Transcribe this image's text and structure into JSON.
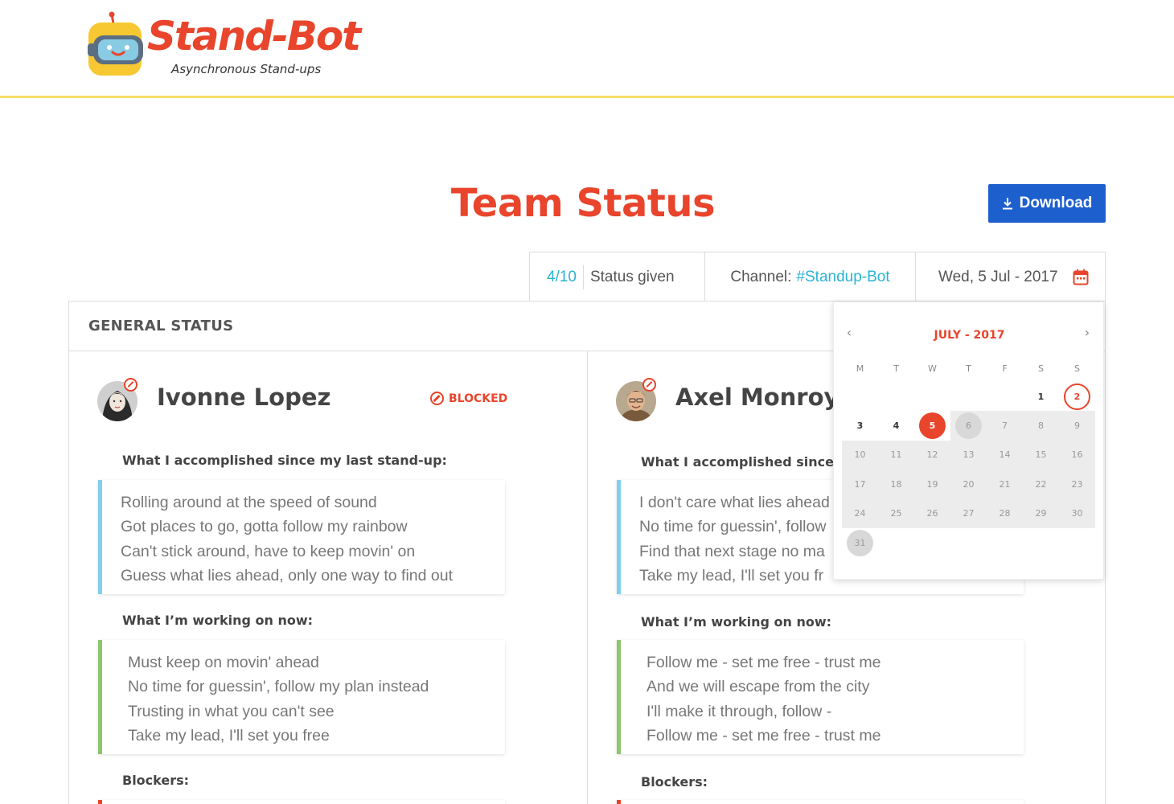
{
  "brand": {
    "name": "Stand-Bot",
    "tagline": "Asynchronous Stand-ups",
    "colors": {
      "red": "#e8452c",
      "yellow": "#f7df68",
      "blue": "#1e5fce",
      "cyan": "#29b3d3"
    }
  },
  "page": {
    "title": "Team Status"
  },
  "toolbar": {
    "download_label": "Download",
    "download_icon": "download-icon"
  },
  "status_bar": {
    "count": "4/10",
    "given_label": "Status given",
    "channel_label": "Channel:",
    "channel_value": "#Standup-Bot",
    "date_value": "Wed, 5 Jul - 2017",
    "date_icon": "calendar-icon"
  },
  "card": {
    "heading": "GENERAL STATUS"
  },
  "members": [
    {
      "name": "Ivonne Lopez",
      "status": "BLOCKED",
      "q1": "What I accomplished since my last stand-up:",
      "a1": [
        "Rolling around at the speed of sound",
        "Got places to go, gotta follow my rainbow",
        "Can't stick around, have to keep movin' on",
        "Guess what lies ahead, only one way to find out"
      ],
      "q2": "What I’m working on now:",
      "a2": [
        "Must keep on movin' ahead",
        "No time for guessin', follow my plan instead",
        "Trusting in what you can't see",
        "Take my lead, I'll set you free"
      ],
      "q3": "Blockers:"
    },
    {
      "name": "Axel Monroy",
      "q1": "What I accomplished since n",
      "a1": [
        "I don't care what lies ahead",
        "No time for guessin', follow",
        "Find that next stage no ma",
        "Take my lead, I'll set you fr"
      ],
      "q2": "What I’m working on now:",
      "a2": [
        "Follow me - set me free - trust me",
        "And we will escape from the city",
        "I'll make it through, follow -",
        "Follow me - set me free - trust me"
      ],
      "q3": "Blockers:"
    }
  ],
  "calendar": {
    "month_label": "JULY - 2017",
    "prev": "‹",
    "next": "›",
    "weekdays": [
      "M",
      "T",
      "W",
      "T",
      "F",
      "S",
      "S"
    ],
    "selected_day": "5",
    "today_day": "2",
    "leading_blanks": 5,
    "days": [
      "1",
      "2",
      "3",
      "4",
      "5",
      "6",
      "7",
      "8",
      "9",
      "10",
      "11",
      "12",
      "13",
      "14",
      "15",
      "16",
      "17",
      "18",
      "19",
      "20",
      "21",
      "22",
      "23",
      "24",
      "25",
      "26",
      "27",
      "28",
      "29",
      "30",
      "31"
    ]
  }
}
